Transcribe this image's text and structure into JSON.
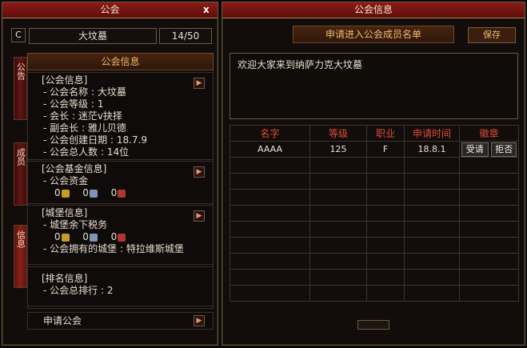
{
  "left_panel": {
    "title": "公会",
    "close": "x",
    "guild_name": "大坟墓",
    "member_count": "14/50",
    "header": "公会信息",
    "tabs": [
      "公告",
      "成员",
      "信息"
    ],
    "info_section": {
      "title": "[公会信息]",
      "lines": [
        "- 公会名称 : 大坟墓",
        "- 公会等级 : 1",
        "- 会长 : 迷茫v抉择",
        "- 副会长 : 雅儿贝德",
        "- 公会创建日期 : 18.7.9",
        "- 公会总人数 : 14位"
      ]
    },
    "fund_section": {
      "title": "[公会基金信息]",
      "line": "- 公会资金",
      "coins": [
        "0",
        "0",
        "0"
      ]
    },
    "castle_section": {
      "title": "[城堡信息]",
      "tax_line": "- 城堡余下税务",
      "coins": [
        "0",
        "0",
        "0"
      ],
      "castle_line": "- 公会拥有的城堡 : 特拉维斯城堡"
    },
    "rank_section": {
      "title": "[排名信息]",
      "line": "- 公会总排行 : 2"
    },
    "apply_button": "申请公会"
  },
  "right_panel": {
    "title": "公会信息",
    "list_title": "申请进入公会成员名单",
    "save": "保存",
    "notice": "欢迎大家来到纳萨力克大坟墓",
    "table": {
      "headers": [
        "名字",
        "等级",
        "职业",
        "申请时间",
        "徽章"
      ],
      "rows": [
        {
          "name": "AAAA",
          "level": "125",
          "job": "F",
          "time": "18.8.1",
          "accept": "受请",
          "reject": "拒否"
        }
      ]
    }
  },
  "colors": {
    "title_red": "#7a1412",
    "header_gold": "#f0b870",
    "table_header_red": "#e04b36",
    "coin_gold": "#c89a2a",
    "coin_silver": "#7f93b6",
    "coin_red": "#b1362c"
  }
}
